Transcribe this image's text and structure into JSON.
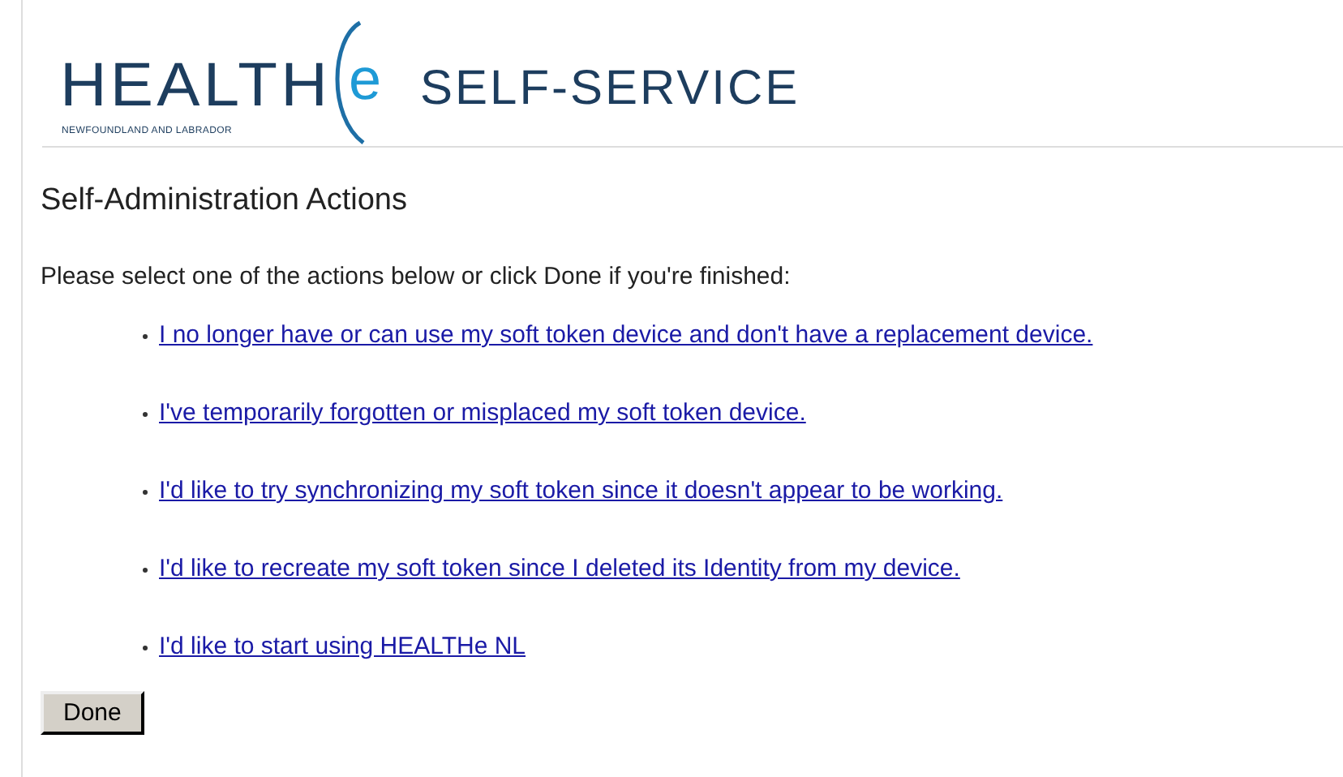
{
  "logo": {
    "brand": "HEALTH",
    "mark": "e",
    "subtitle": "NEWFOUNDLAND AND LABRADOR",
    "product": "SELF-SERVICE"
  },
  "heading": "Self-Administration Actions",
  "intro": "Please select one of the actions below or click Done if you're finished:",
  "actions": [
    {
      "label": "I no longer have or can use my soft token device and don't have a replacement device."
    },
    {
      "label": "I've temporarily forgotten or misplaced my soft token device."
    },
    {
      "label": "I'd like to try synchronizing my soft token since it doesn't appear to be working."
    },
    {
      "label": "I'd like to recreate my soft token since I deleted its Identity from my device."
    },
    {
      "label": "I'd like to start using HEALTHe NL"
    }
  ],
  "done_button": "Done"
}
